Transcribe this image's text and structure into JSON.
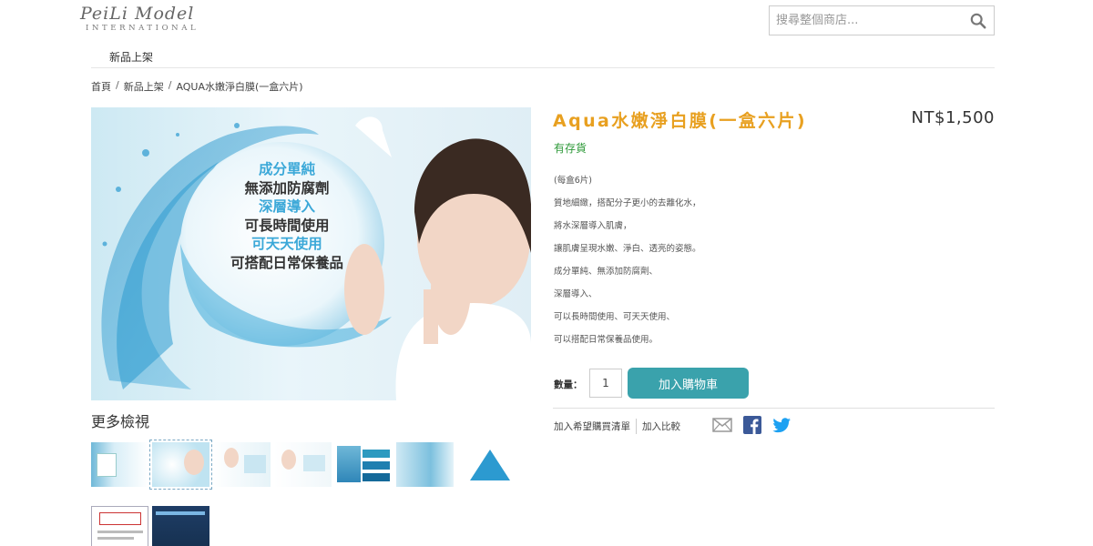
{
  "header": {
    "logo_main": "PeiLi Model",
    "logo_sub": "INTERNATIONAL",
    "search_placeholder": "搜尋整個商店..."
  },
  "nav": {
    "items": [
      "新品上架"
    ]
  },
  "breadcrumb": {
    "items": [
      "首頁",
      "新品上架",
      "AQUA水嫩淨白膜(一盒六片)"
    ],
    "separator": "/"
  },
  "product": {
    "title": "Aqua水嫩淨白膜(一盒六片)",
    "price": "NT$1,500",
    "stock": "有存貨",
    "description": [
      "(每盒6片)",
      "質地細緻，搭配分子更小的去離化水，",
      "將水深層導入肌膚，",
      "讓肌膚呈現水嫩、淨白、透亮的姿態。",
      "成分單純、無添加防腐劑、",
      "深層導入、",
      "可以長時間使用、可天天使用、",
      "可以搭配日常保養品使用。"
    ],
    "qty_label": "數量：",
    "qty_value": "1",
    "add_to_cart": "加入購物車",
    "wishlist": "加入希望購買清單",
    "compare": "加入比較"
  },
  "hero": {
    "lines": [
      {
        "text": "成分單純",
        "style": "c"
      },
      {
        "text": "無添加防腐劑",
        "style": "d"
      },
      {
        "text": "深層導入",
        "style": "c"
      },
      {
        "text": "可長時間使用",
        "style": "d"
      },
      {
        "text": "可天天使用",
        "style": "c"
      },
      {
        "text": "可搭配日常保養品",
        "style": "d"
      }
    ]
  },
  "gallery": {
    "title": "更多檢視",
    "thumb_count": 9,
    "selected_index": 1
  },
  "colors": {
    "title": "#e8a020",
    "stock": "#2f9a3a",
    "button": "#3aa2ac",
    "facebook": "#3b5998",
    "twitter": "#1da1f2"
  },
  "icons": [
    "search-icon",
    "mail-icon",
    "facebook-icon",
    "twitter-icon"
  ]
}
